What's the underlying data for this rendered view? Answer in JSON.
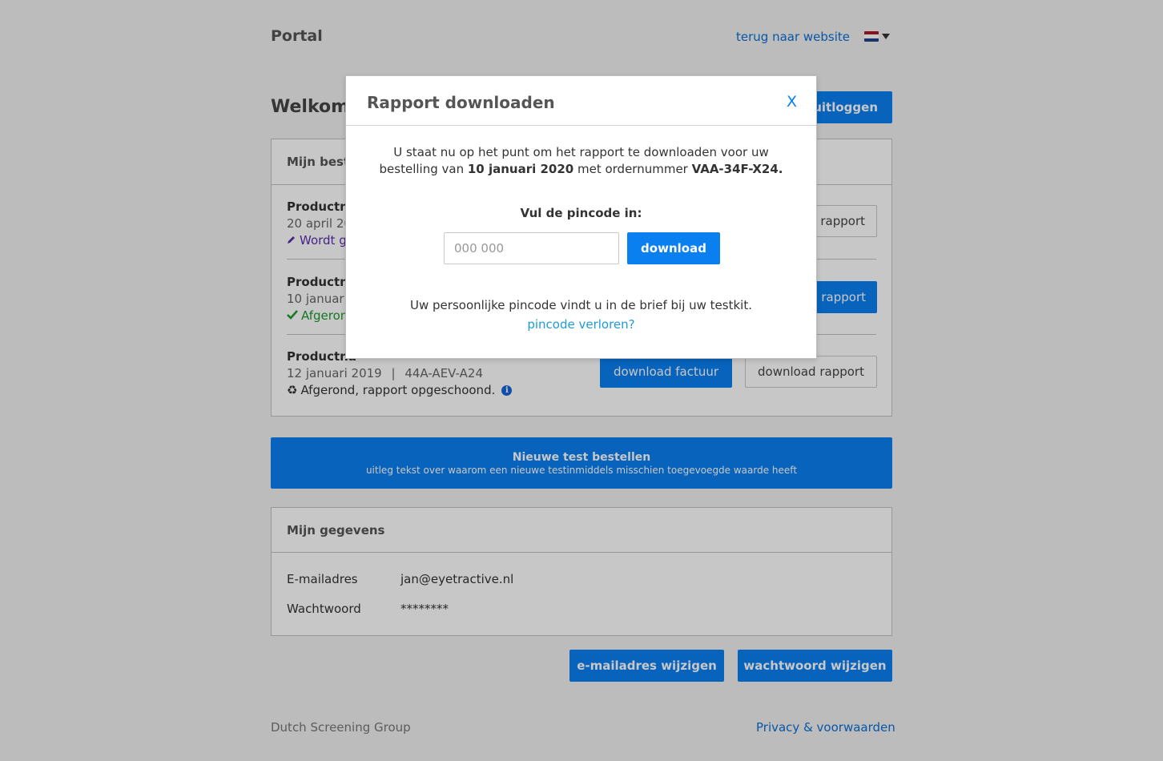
{
  "header": {
    "portal_title": "Portal",
    "back_link": "terug naar website",
    "language_flag_icon": "netherlands-flag-icon"
  },
  "welcome": {
    "text": "Welkom,",
    "logout_label": "uitloggen"
  },
  "orders": {
    "heading": "Mijn beste",
    "items": [
      {
        "title": "Productna",
        "meta": "20 april 20",
        "status": "Wordt g",
        "status_icon": "pencil-icon",
        "button_label": "rapport"
      },
      {
        "title": "Productna",
        "meta": "10 januari",
        "status": "Afgeron",
        "status_icon": "checkmark-icon",
        "button_label": "rapport"
      },
      {
        "title": "Productna",
        "meta_date": "12 januari 2019",
        "meta_separator": "|",
        "meta_code": "44A-AEV-A24",
        "status": "Afgerond, rapport opgeschoond.",
        "status_icon": "recycle-icon",
        "info_icon": "info-icon",
        "invoice_label": "download factuur",
        "report_label": "download rapport"
      }
    ]
  },
  "banner": {
    "title": "Nieuwe test bestellen",
    "subtitle": "uitleg tekst over waarom een nieuwe testinmiddels misschien toegevoegde waarde heeft"
  },
  "details": {
    "heading": "Mijn gegevens",
    "email_label": "E-mailadres",
    "email_value": "jan@eyetractive.nl",
    "password_label": "Wachtwoord",
    "password_value": "********",
    "change_email_label": "e-mailadres wijzigen",
    "change_password_label": "wachtwoord wijzigen"
  },
  "footer": {
    "company": "Dutch Screening Group",
    "privacy_link": "Privacy & voorwaarden"
  },
  "modal": {
    "title": "Rapport downloaden",
    "close_label": "X",
    "text_part1": "U staat nu op het punt om het rapport te downloaden voor uw bestelling van ",
    "order_date": "10 januari 2020",
    "text_part2": " met ordernummer ",
    "order_number": "VAA-34F-X24.",
    "pin_label": "Vul de pincode in:",
    "pin_placeholder": "000 000",
    "download_label": "download",
    "hint": "Uw persoonlijke pincode vindt u in de brief bij uw testkit.",
    "lost_link": "pincode verloren?"
  },
  "colors": {
    "primary": "#0a7ff0",
    "link": "#0b6fd6",
    "link_light": "#1e9bd7",
    "status_green": "#1a9a2d",
    "status_purple": "#5b2fa8"
  }
}
